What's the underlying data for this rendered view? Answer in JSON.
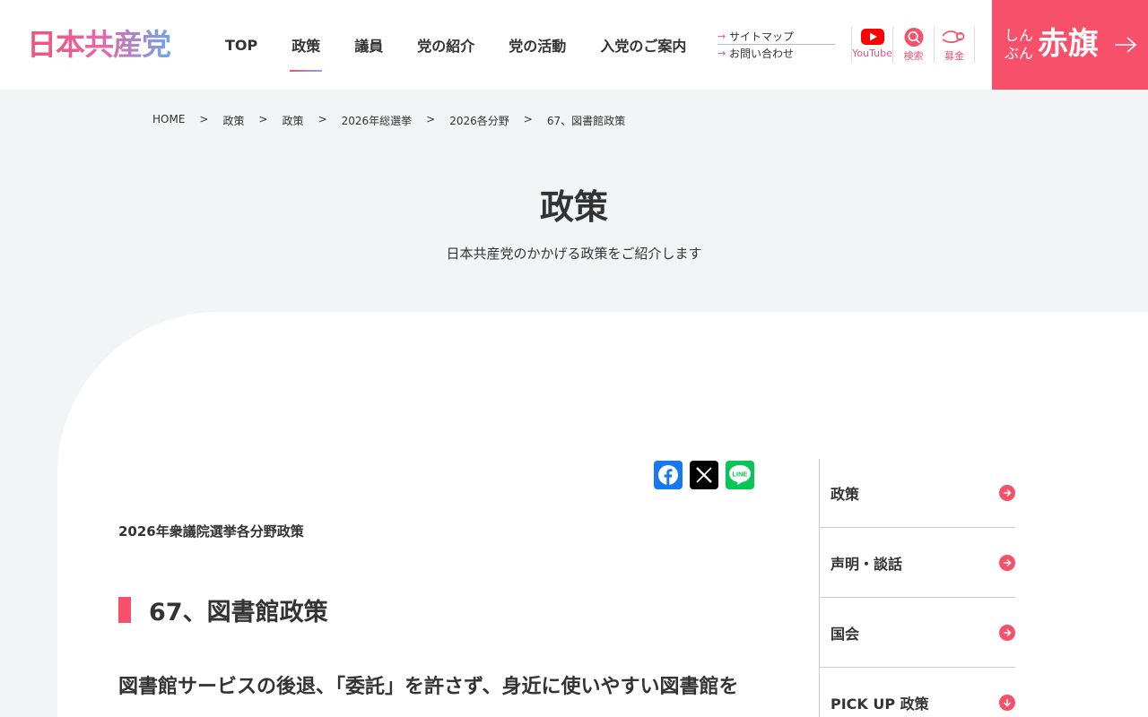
{
  "header": {
    "logo": "日本共産党",
    "nav": [
      {
        "label": "TOP",
        "active": false
      },
      {
        "label": "政策",
        "active": true
      },
      {
        "label": "議員",
        "active": false
      },
      {
        "label": "党の紹介",
        "active": false
      },
      {
        "label": "党の活動",
        "active": false
      },
      {
        "label": "入党のご案内",
        "active": false
      }
    ],
    "subnav": [
      "サイトマップ",
      "お問い合わせ"
    ],
    "icons": [
      {
        "icon": "youtube-icon",
        "label": "YouTube"
      },
      {
        "icon": "search-icon",
        "label": "検索"
      },
      {
        "icon": "donation-icon",
        "label": "募金"
      }
    ],
    "akahata": {
      "small": "しんぶん",
      "big": "赤旗"
    }
  },
  "breadcrumb": [
    "HOME",
    "政策",
    "政策",
    "2026年総選挙",
    "2026各分野",
    "67、図書館政策"
  ],
  "breadcrumb_separator": ">",
  "hero": {
    "title": "政策",
    "lead": "日本共産党のかかげる政策をご紹介します"
  },
  "article": {
    "eyebrow": "2026年衆議院選挙各分野政策",
    "title": "67、図書館政策",
    "lead_heading": "図書館サービスの後退、「委託」を許さず、身近に使いやすい図書館を"
  },
  "share": [
    {
      "name": "facebook-share-button",
      "icon": "facebook-icon"
    },
    {
      "name": "x-share-button",
      "icon": "x-icon"
    },
    {
      "name": "line-share-button",
      "icon": "line-icon",
      "label": "LINE"
    }
  ],
  "sidebar": [
    "政策",
    "声明・談話",
    "国会",
    "PICK UP 政策"
  ],
  "colors": {
    "brand_pink": "#f6506a",
    "background": "#f3f4f6",
    "text": "#333333"
  }
}
